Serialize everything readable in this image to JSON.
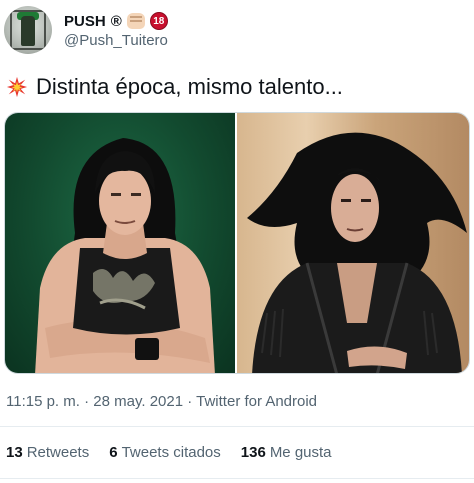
{
  "user": {
    "display_name": "PUSH",
    "reg_mark": "®",
    "badge_18": "18",
    "handle": "@Push_Tuitero"
  },
  "tweet": {
    "text": "Distinta época, mismo talento...",
    "text_emoji_icon": "collision-icon"
  },
  "meta": {
    "time": "11:15 p. m.",
    "date": "28 may. 2021",
    "separator": "·",
    "source": "Twitter for Android"
  },
  "stats": {
    "retweets_count": "13",
    "retweets_label": "Retweets",
    "quotes_count": "6",
    "quotes_label": "Tweets citados",
    "likes_count": "136",
    "likes_label": "Me gusta"
  },
  "colors": {
    "text_primary": "#0f1419",
    "text_secondary": "#536471",
    "divider": "#e6ecf0"
  }
}
